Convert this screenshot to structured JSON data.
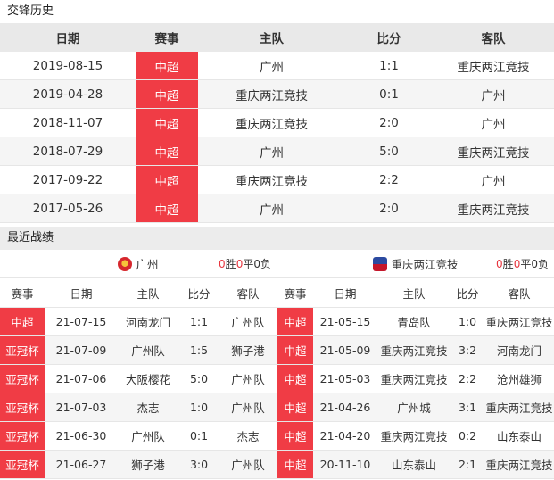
{
  "history": {
    "title": "交锋历史",
    "headers": {
      "date": "日期",
      "comp": "赛事",
      "home": "主队",
      "score": "比分",
      "away": "客队"
    },
    "rows": [
      {
        "date": "2019-08-15",
        "comp": "中超",
        "home": "广州",
        "score": "1:1",
        "away": "重庆两江竞技"
      },
      {
        "date": "2019-04-28",
        "comp": "中超",
        "home": "重庆两江竞技",
        "score": "0:1",
        "away": "广州"
      },
      {
        "date": "2018-11-07",
        "comp": "中超",
        "home": "重庆两江竞技",
        "score": "2:0",
        "away": "广州"
      },
      {
        "date": "2018-07-29",
        "comp": "中超",
        "home": "广州",
        "score": "5:0",
        "away": "重庆两江竞技"
      },
      {
        "date": "2017-09-22",
        "comp": "中超",
        "home": "重庆两江竞技",
        "score": "2:2",
        "away": "广州"
      },
      {
        "date": "2017-05-26",
        "comp": "中超",
        "home": "广州",
        "score": "2:0",
        "away": "重庆两江竞技"
      }
    ]
  },
  "recent": {
    "title": "最近战绩",
    "headers": {
      "comp": "赛事",
      "date": "日期",
      "home": "主队",
      "score": "比分",
      "away": "客队"
    },
    "left": {
      "team": "广州",
      "wins": "0",
      "win_label": "胜",
      "draws": "0",
      "draw_label": "平",
      "losses": "0",
      "loss_label": "负",
      "rows": [
        {
          "comp": "中超",
          "date": "21-07-15",
          "home": "河南龙门",
          "score": "1:1",
          "away": "广州队"
        },
        {
          "comp": "亚冠杯",
          "date": "21-07-09",
          "home": "广州队",
          "score": "1:5",
          "away": "狮子港"
        },
        {
          "comp": "亚冠杯",
          "date": "21-07-06",
          "home": "大阪樱花",
          "score": "5:0",
          "away": "广州队"
        },
        {
          "comp": "亚冠杯",
          "date": "21-07-03",
          "home": "杰志",
          "score": "1:0",
          "away": "广州队"
        },
        {
          "comp": "亚冠杯",
          "date": "21-06-30",
          "home": "广州队",
          "score": "0:1",
          "away": "杰志"
        },
        {
          "comp": "亚冠杯",
          "date": "21-06-27",
          "home": "狮子港",
          "score": "3:0",
          "away": "广州队"
        }
      ]
    },
    "right": {
      "team": "重庆两江竞技",
      "wins": "0",
      "win_label": "胜",
      "draws": "0",
      "draw_label": "平",
      "losses": "0",
      "loss_label": "负",
      "rows": [
        {
          "comp": "中超",
          "date": "21-05-15",
          "home": "青岛队",
          "score": "1:0",
          "away": "重庆两江竞技"
        },
        {
          "comp": "中超",
          "date": "21-05-09",
          "home": "重庆两江竞技",
          "score": "3:2",
          "away": "河南龙门"
        },
        {
          "comp": "中超",
          "date": "21-05-03",
          "home": "重庆两江竞技",
          "score": "2:2",
          "away": "沧州雄狮"
        },
        {
          "comp": "中超",
          "date": "21-04-26",
          "home": "广州城",
          "score": "3:1",
          "away": "重庆两江竞技"
        },
        {
          "comp": "中超",
          "date": "21-04-20",
          "home": "重庆两江竞技",
          "score": "0:2",
          "away": "山东泰山"
        },
        {
          "comp": "中超",
          "date": "20-11-10",
          "home": "山东泰山",
          "score": "2:1",
          "away": "重庆两江竞技"
        }
      ]
    }
  },
  "colors": {
    "badge": "#f03c45",
    "header_bg": "#e9e9e9",
    "alt_row": "#f5f5f5"
  }
}
